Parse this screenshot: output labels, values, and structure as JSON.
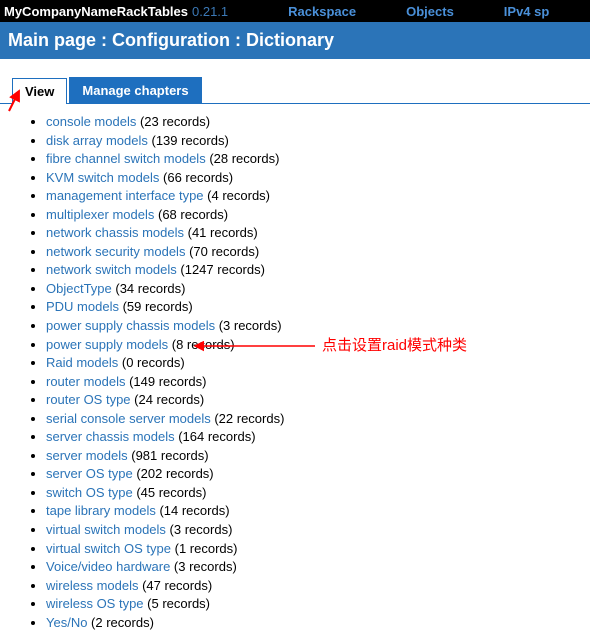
{
  "topbar": {
    "brand_prefix": "MyCompanyName",
    "brand_suffix": " RackTables",
    "version": "0.21.1",
    "nav": [
      "Rackspace",
      "Objects",
      "IPv4 sp"
    ]
  },
  "breadcrumb": "Main page : Configuration : Dictionary",
  "tabs": {
    "active": "View",
    "inactive": "Manage chapters"
  },
  "records_word": "records",
  "dictionary": [
    {
      "name": "console models",
      "count": 23
    },
    {
      "name": "disk array models",
      "count": 139
    },
    {
      "name": "fibre channel switch models",
      "count": 28
    },
    {
      "name": "KVM switch models",
      "count": 66
    },
    {
      "name": "management interface type",
      "count": 4
    },
    {
      "name": "multiplexer models",
      "count": 68
    },
    {
      "name": "network chassis models",
      "count": 41
    },
    {
      "name": "network security models",
      "count": 70
    },
    {
      "name": "network switch models",
      "count": 1247
    },
    {
      "name": "ObjectType",
      "count": 34
    },
    {
      "name": "PDU models",
      "count": 59
    },
    {
      "name": "power supply chassis models",
      "count": 3
    },
    {
      "name": "power supply models",
      "count": 8
    },
    {
      "name": "Raid models",
      "count": 0
    },
    {
      "name": "router models",
      "count": 149
    },
    {
      "name": "router OS type",
      "count": 24
    },
    {
      "name": "serial console server models",
      "count": 22
    },
    {
      "name": "server chassis models",
      "count": 164
    },
    {
      "name": "server models",
      "count": 981
    },
    {
      "name": "server OS type",
      "count": 202
    },
    {
      "name": "switch OS type",
      "count": 45
    },
    {
      "name": "tape library models",
      "count": 14
    },
    {
      "name": "virtual switch models",
      "count": 3
    },
    {
      "name": "virtual switch OS type",
      "count": 1
    },
    {
      "name": "Voice/video hardware",
      "count": 3
    },
    {
      "name": "wireless models",
      "count": 47
    },
    {
      "name": "wireless OS type",
      "count": 5
    },
    {
      "name": "Yes/No",
      "count": 2
    }
  ],
  "annotation": {
    "text": "点击设置raid模式种类"
  }
}
